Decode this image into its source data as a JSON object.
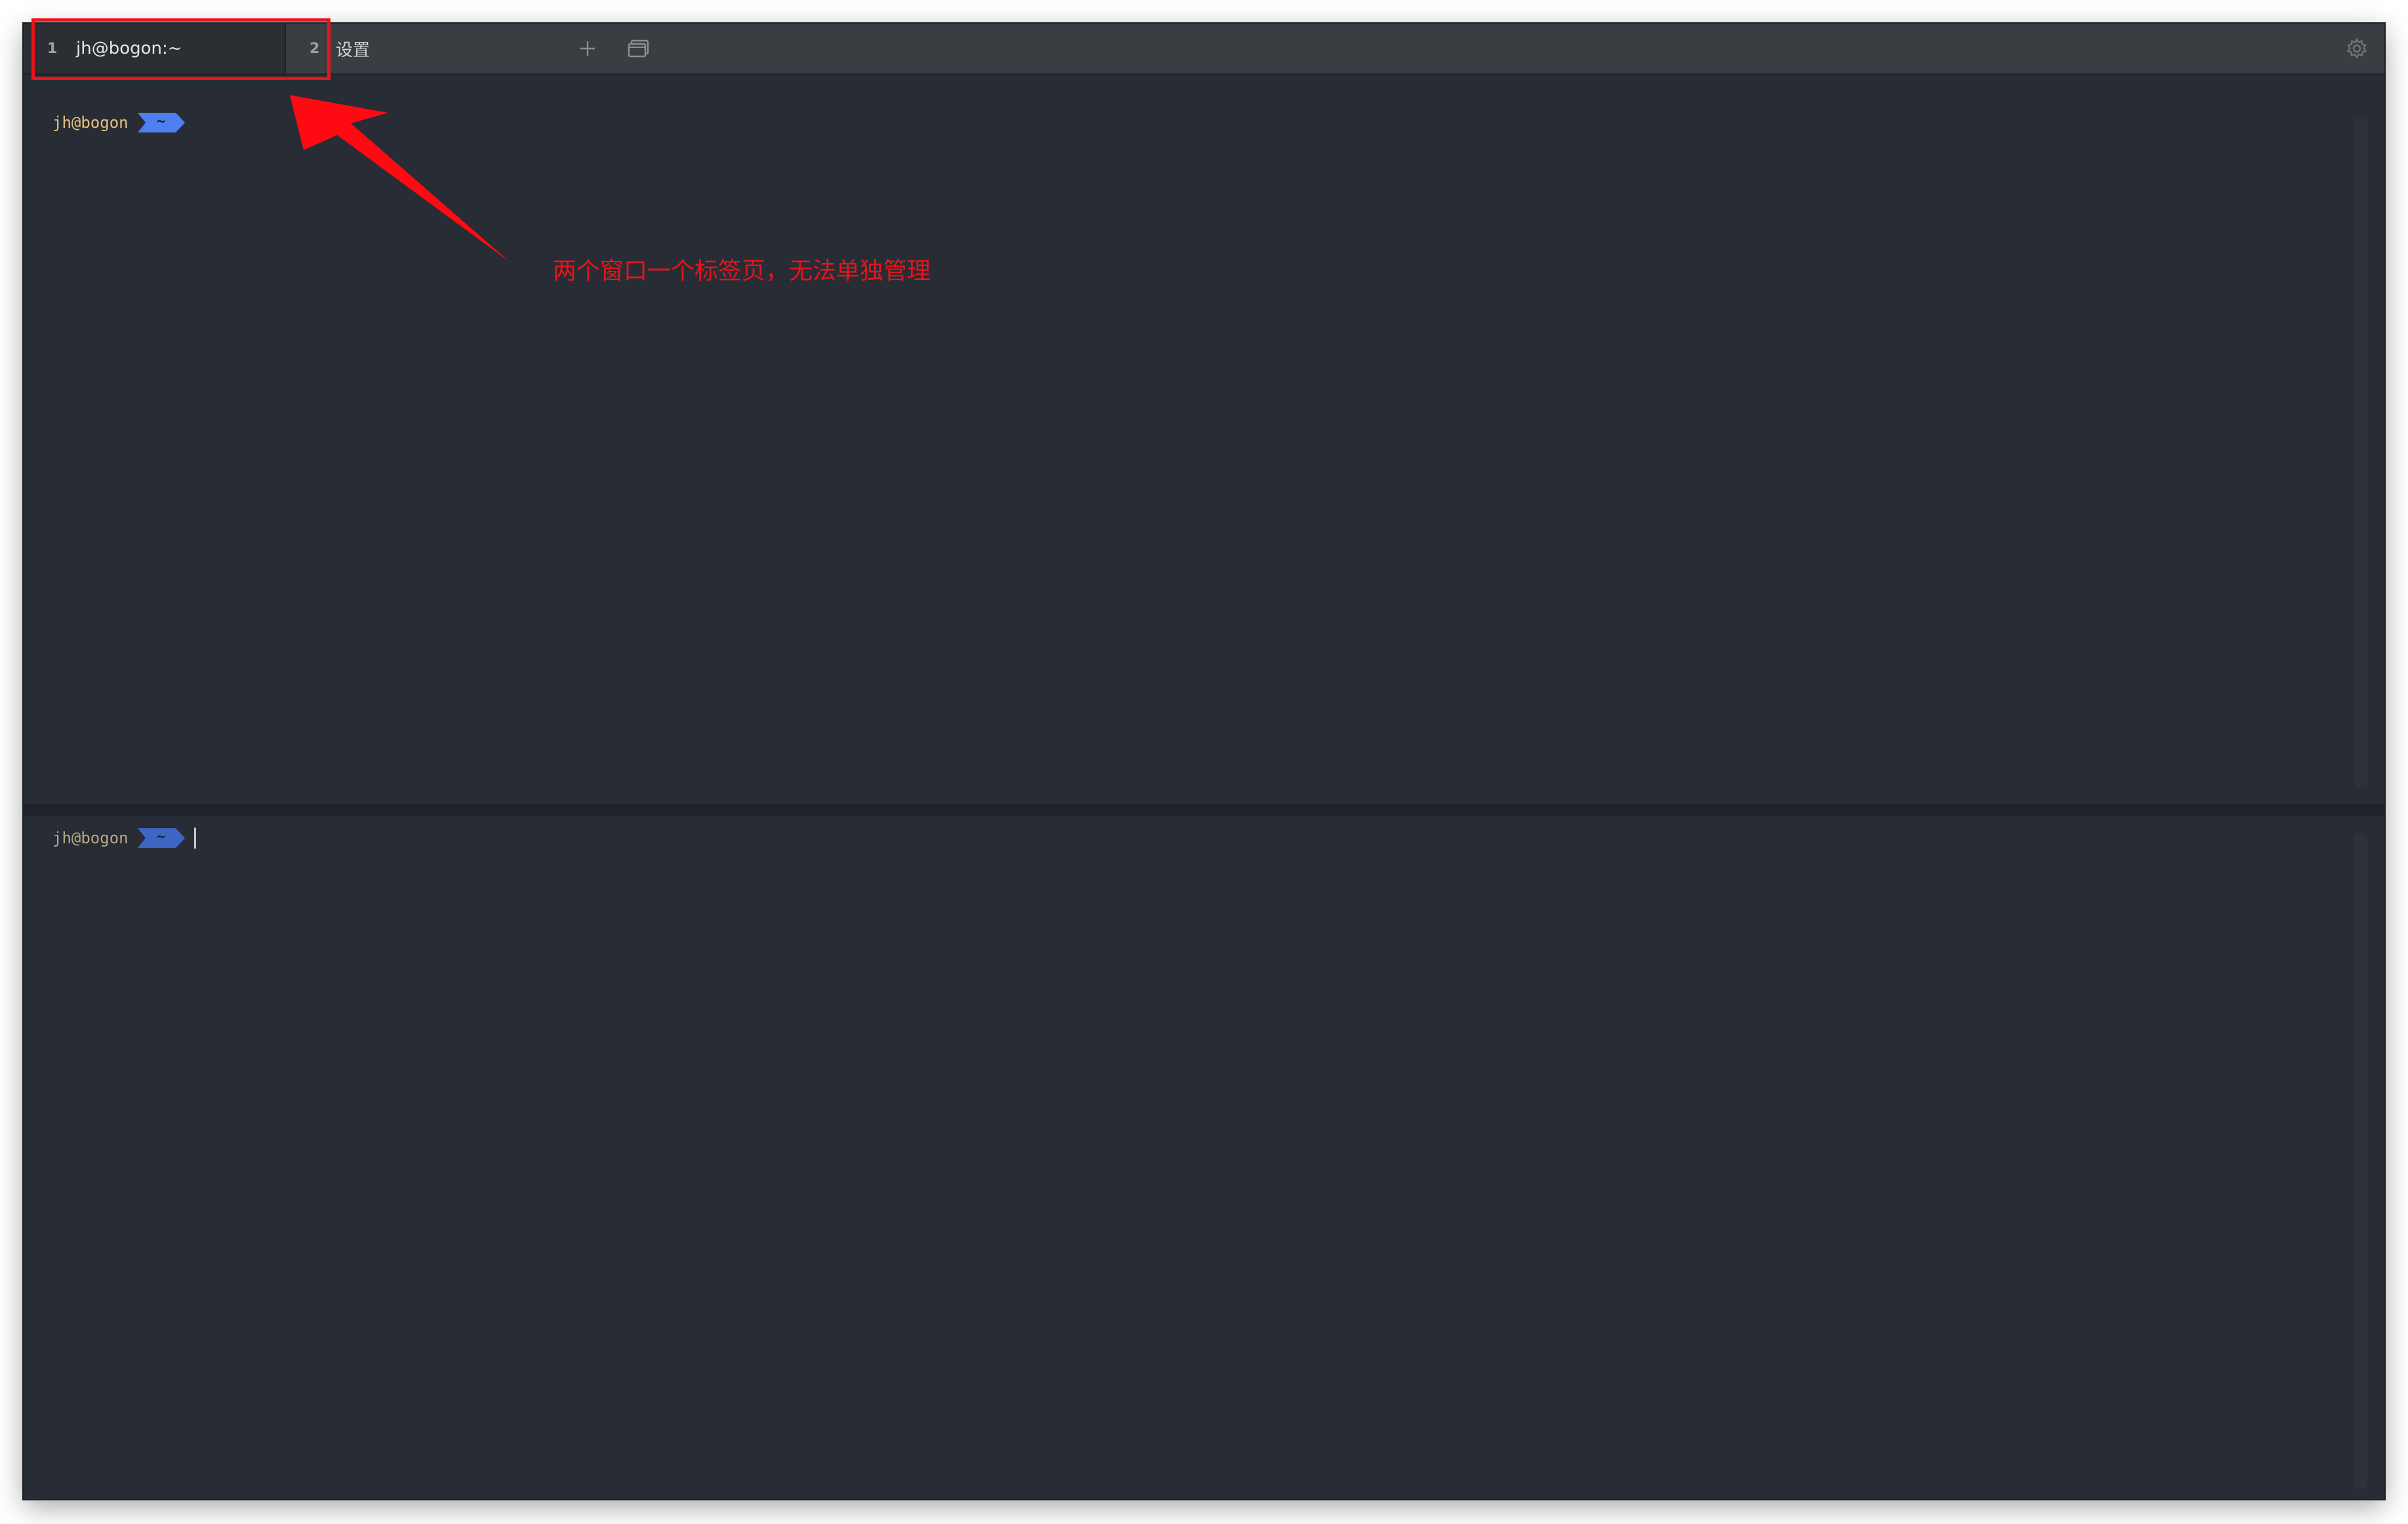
{
  "tabs": [
    {
      "number": "1",
      "title": "jh@bogon:~"
    },
    {
      "number": "2",
      "title": "设置"
    }
  ],
  "toolbar": {
    "new_tab_icon": "plus-icon",
    "window_icon": "window-icon",
    "settings_icon": "gear-icon"
  },
  "panes": {
    "top": {
      "host": "jh@bogon",
      "dir": "~"
    },
    "bottom": {
      "host": "jh@bogon",
      "dir": "~"
    }
  },
  "annotation": {
    "text": "两个窗口一个标签页，无法单独管理",
    "color": "#e8141b"
  },
  "colors": {
    "terminal_bg": "#282c34",
    "tabbar_bg": "#3a3d42",
    "prompt_host": "#e5c07b",
    "prompt_dir_bg": "#4f7ef0"
  }
}
